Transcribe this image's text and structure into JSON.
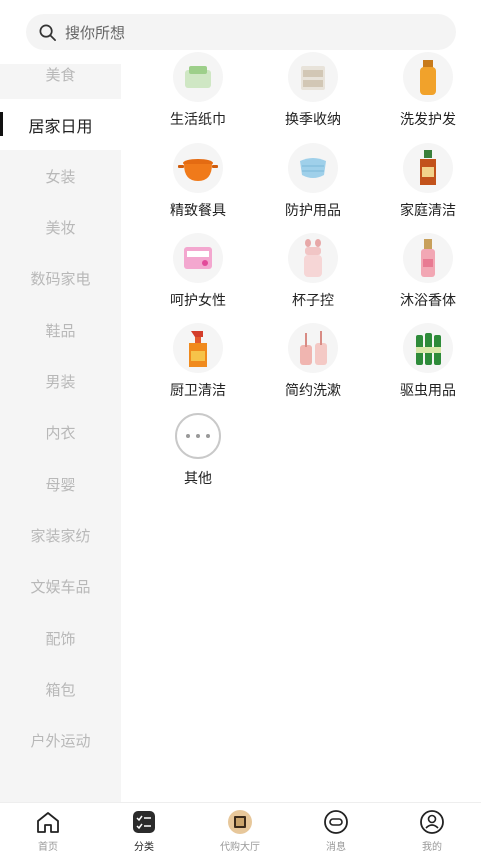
{
  "search": {
    "placeholder": "搜你所想"
  },
  "sidebar": {
    "items": [
      {
        "label": "美食"
      },
      {
        "label": "居家日用",
        "active": true
      },
      {
        "label": "女装"
      },
      {
        "label": "美妆"
      },
      {
        "label": "数码家电"
      },
      {
        "label": "鞋品"
      },
      {
        "label": "男装"
      },
      {
        "label": "内衣"
      },
      {
        "label": "母婴"
      },
      {
        "label": "家装家纺"
      },
      {
        "label": "文娱车品"
      },
      {
        "label": "配饰"
      },
      {
        "label": "箱包"
      },
      {
        "label": "户外运动"
      }
    ]
  },
  "categories": [
    {
      "label": "生活纸巾",
      "icon": "tissue-pack-icon"
    },
    {
      "label": "换季收纳",
      "icon": "storage-drawer-icon"
    },
    {
      "label": "洗发护发",
      "icon": "shampoo-bottle-icon"
    },
    {
      "label": "精致餐具",
      "icon": "cooking-pot-icon"
    },
    {
      "label": "防护用品",
      "icon": "face-mask-icon"
    },
    {
      "label": "家庭清洁",
      "icon": "disinfectant-bottle-icon"
    },
    {
      "label": "呵护女性",
      "icon": "sanitary-pad-icon"
    },
    {
      "label": "杯子控",
      "icon": "water-cup-icon"
    },
    {
      "label": "沐浴香体",
      "icon": "perfume-bottle-icon"
    },
    {
      "label": "厨卫清洁",
      "icon": "spray-cleaner-icon"
    },
    {
      "label": "简约洗漱",
      "icon": "toothbrush-cup-icon"
    },
    {
      "label": "驱虫用品",
      "icon": "repellent-bottles-icon"
    },
    {
      "label": "其他",
      "icon": "more-icon"
    }
  ],
  "tabbar": {
    "items": [
      {
        "label": "首页",
        "icon": "home-icon"
      },
      {
        "label": "分类",
        "icon": "category-icon",
        "active": true
      },
      {
        "label": "代购大厅",
        "icon": "purchase-hall-icon"
      },
      {
        "label": "消息",
        "icon": "message-icon"
      },
      {
        "label": "我的",
        "icon": "profile-icon"
      }
    ]
  },
  "colors": {
    "active_text": "#222222",
    "inactive_text": "#b8b8b8",
    "sidebar_bg": "#f5f5f5"
  }
}
